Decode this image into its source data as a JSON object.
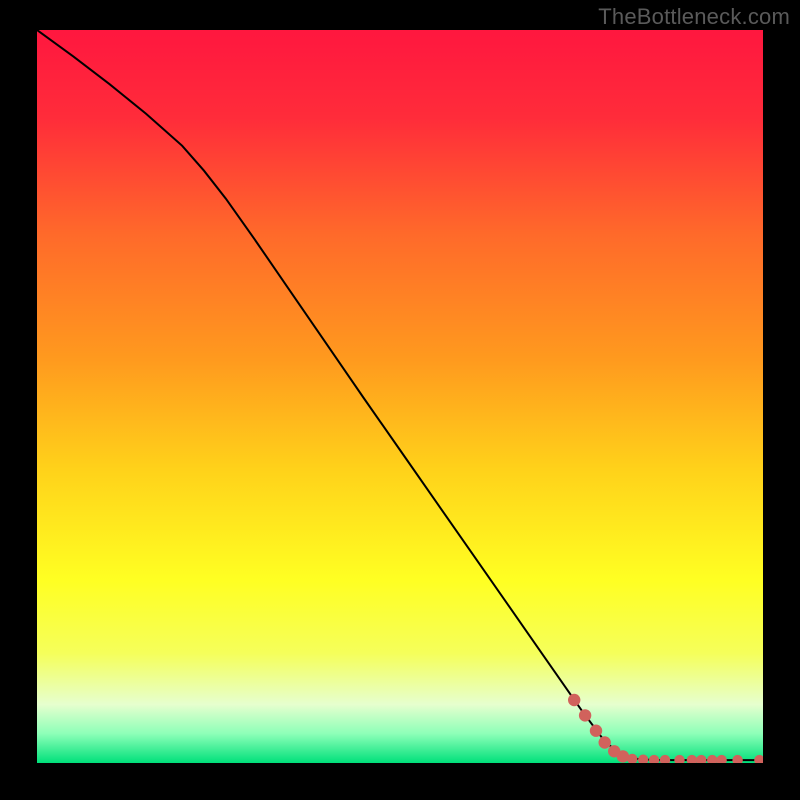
{
  "watermark": "TheBottleneck.com",
  "chart_data": {
    "type": "line",
    "title": "",
    "xlabel": "",
    "ylabel": "",
    "xlim": [
      0,
      100
    ],
    "ylim": [
      0,
      100
    ],
    "grid": false,
    "legend": false,
    "background": {
      "kind": "vertical-gradient",
      "stops": [
        {
          "pct": 0,
          "color": "#ff173f"
        },
        {
          "pct": 12,
          "color": "#ff2c3a"
        },
        {
          "pct": 28,
          "color": "#ff6a2a"
        },
        {
          "pct": 45,
          "color": "#ff9a1e"
        },
        {
          "pct": 60,
          "color": "#ffd21a"
        },
        {
          "pct": 75,
          "color": "#ffff22"
        },
        {
          "pct": 85,
          "color": "#f5ff5a"
        },
        {
          "pct": 92,
          "color": "#e6ffce"
        },
        {
          "pct": 96,
          "color": "#8dffb8"
        },
        {
          "pct": 100,
          "color": "#00e07a"
        }
      ]
    },
    "series": [
      {
        "name": "curve",
        "style": "solid-black",
        "data": [
          {
            "x": 0,
            "y": 100.0
          },
          {
            "x": 5,
            "y": 96.4
          },
          {
            "x": 10,
            "y": 92.6
          },
          {
            "x": 15,
            "y": 88.6
          },
          {
            "x": 20,
            "y": 84.2
          },
          {
            "x": 23,
            "y": 80.8
          },
          {
            "x": 26,
            "y": 77.0
          },
          {
            "x": 30,
            "y": 71.4
          },
          {
            "x": 35,
            "y": 64.2
          },
          {
            "x": 40,
            "y": 57.0
          },
          {
            "x": 45,
            "y": 49.8
          },
          {
            "x": 50,
            "y": 42.7
          },
          {
            "x": 55,
            "y": 35.6
          },
          {
            "x": 60,
            "y": 28.5
          },
          {
            "x": 65,
            "y": 21.4
          },
          {
            "x": 70,
            "y": 14.3
          },
          {
            "x": 75,
            "y": 7.2
          },
          {
            "x": 78,
            "y": 3.2
          },
          {
            "x": 80,
            "y": 1.4
          },
          {
            "x": 82,
            "y": 0.6
          },
          {
            "x": 85,
            "y": 0.4
          },
          {
            "x": 90,
            "y": 0.4
          },
          {
            "x": 95,
            "y": 0.4
          },
          {
            "x": 100,
            "y": 0.4
          }
        ]
      },
      {
        "name": "highlight-band",
        "style": "thick-dotted-red",
        "color": "#d1625c",
        "data": [
          {
            "x": 74.0,
            "y": 8.6
          },
          {
            "x": 75.5,
            "y": 6.5
          },
          {
            "x": 77.0,
            "y": 4.4
          },
          {
            "x": 78.2,
            "y": 2.8
          },
          {
            "x": 79.5,
            "y": 1.6
          },
          {
            "x": 80.7,
            "y": 0.9
          },
          {
            "x": 82.0,
            "y": 0.55
          },
          {
            "x": 83.5,
            "y": 0.45
          },
          {
            "x": 85.0,
            "y": 0.4
          },
          {
            "x": 86.5,
            "y": 0.4
          },
          {
            "x": 88.5,
            "y": 0.4
          },
          {
            "x": 90.2,
            "y": 0.4
          },
          {
            "x": 91.5,
            "y": 0.4
          },
          {
            "x": 93.0,
            "y": 0.4
          },
          {
            "x": 94.3,
            "y": 0.4
          },
          {
            "x": 96.5,
            "y": 0.4
          },
          {
            "x": 99.5,
            "y": 0.4
          }
        ]
      }
    ]
  }
}
